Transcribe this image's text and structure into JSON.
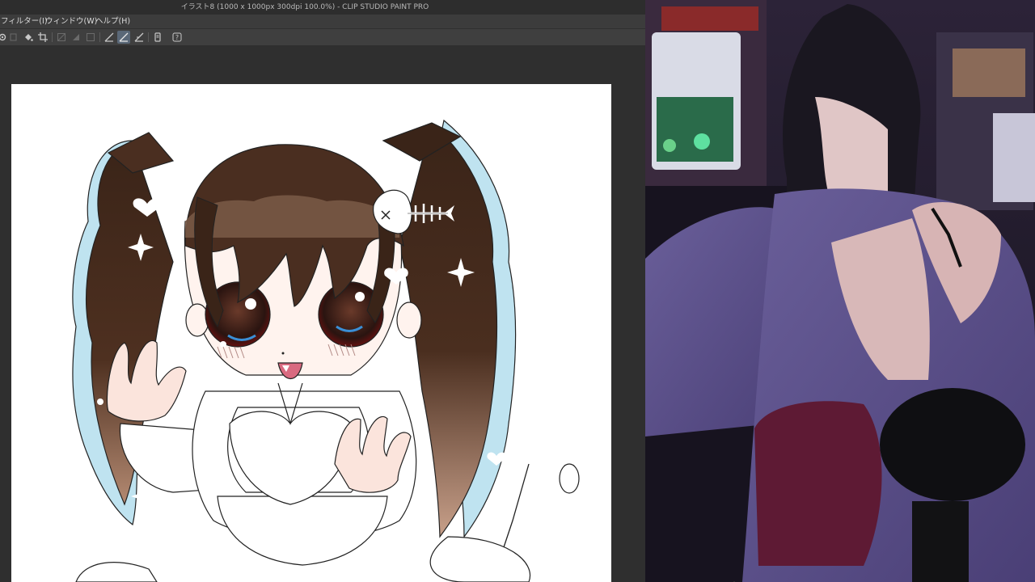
{
  "window": {
    "title": "イラスト8 (1000 x 1000px 300dpi 100.0%)  - CLIP STUDIO PAINT PRO"
  },
  "menu": {
    "items": [
      {
        "label": "フィルター(I)"
      },
      {
        "label": "ウィンドウ(W)"
      },
      {
        "label": "ヘルプ(H)"
      }
    ]
  },
  "toolbar": {
    "icons": [
      "settings-icon",
      "copy-icon",
      "fill-icon",
      "crop-icon",
      "transform-icon",
      "brush-icon",
      "smooth-icon",
      "pen-icon",
      "ruler-icon",
      "snap-ruler-icon",
      "snap-special-icon",
      "phone-icon",
      "help-icon"
    ]
  },
  "colors": {
    "titlebar": "#2d2d2d",
    "menubar": "#3c3c3c",
    "workspace": "#2f2f2f",
    "active_tool": "#5a6878"
  }
}
